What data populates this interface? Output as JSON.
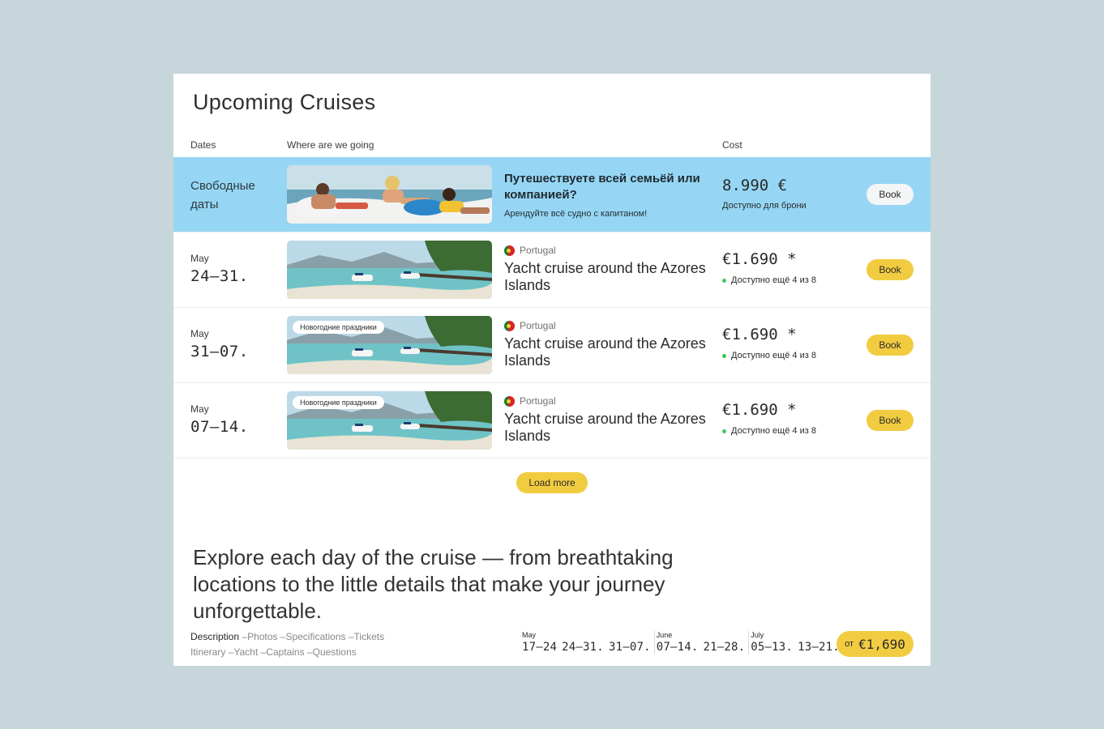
{
  "title": "Upcoming Cruises",
  "columns": {
    "dates": "Dates",
    "destination": "Where are we going",
    "cost": "Cost"
  },
  "promo": {
    "dates_label": "Свободные даты",
    "title": "Путешествуете всей семьёй или компанией?",
    "subtitle": "Арендуйте всё судно с капитаном!",
    "price": "8.990 €",
    "availability": "Доступно для брони",
    "book_label": "Book"
  },
  "cruises": [
    {
      "month": "May",
      "range": "24–31.",
      "badge": "",
      "country": "Portugal",
      "name": "Yacht cruise around the Azores Islands",
      "price": "€1.690 *",
      "availability": "Доступно ещё 4 из 8",
      "book_label": "Book"
    },
    {
      "month": "May",
      "range": "31–07.",
      "badge": "Новогодние праздники",
      "country": "Portugal",
      "name": "Yacht cruise around the Azores Islands",
      "price": "€1.690 *",
      "availability": "Доступно ещё 4 из 8",
      "book_label": "Book"
    },
    {
      "month": "May",
      "range": "07–14.",
      "badge": "Новогодние праздники",
      "country": "Portugal",
      "name": "Yacht cruise around the Azores Islands",
      "price": "€1.690 *",
      "availability": "Доступно ещё 4 из 8",
      "book_label": "Book"
    }
  ],
  "load_more": "Load more",
  "explore_text": "Explore each day of the cruise — from breathtaking locations to the little details that make your journey unforgettable.",
  "links": {
    "line1": [
      "Description",
      "Photos",
      "Specifications",
      "Tickets"
    ],
    "line2": [
      "Itinerary",
      "Yacht",
      "Captains",
      "Questions"
    ],
    "separator": "–"
  },
  "date_strip": [
    {
      "month": "May",
      "range": "17–24"
    },
    {
      "month": "",
      "range": "24–31."
    },
    {
      "month": "",
      "range": "31–07."
    },
    {
      "month": "June",
      "range": "07–14."
    },
    {
      "month": "",
      "range": "21–28."
    },
    {
      "month": "July",
      "range": "05–13."
    },
    {
      "month": "",
      "range": "13–21."
    }
  ],
  "from_button": {
    "label": "от",
    "price": "€1,690"
  },
  "colors": {
    "accent": "#f2cc40",
    "promo_bg": "#96d6f4",
    "page_bg": "#c7d6da",
    "available_dot": "#3bc85a"
  }
}
